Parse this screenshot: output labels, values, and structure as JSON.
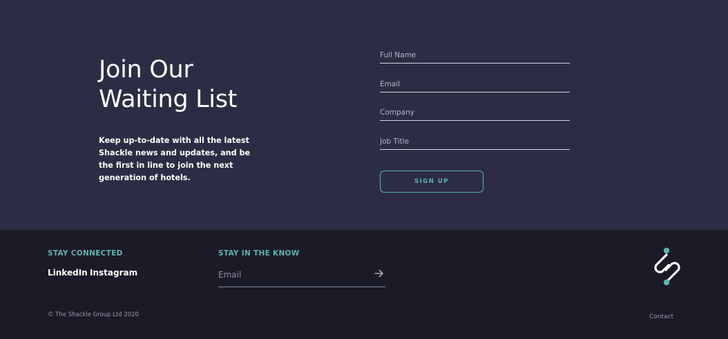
{
  "signup": {
    "heading_line1": "Join Our",
    "heading_line2": "Waiting List",
    "blurb": "Keep up-to-date with all the latest Shackle news and updates, and be the first in line to join the next generation of hotels.",
    "fields": {
      "full_name": {
        "placeholder": "Full Name",
        "value": ""
      },
      "email": {
        "placeholder": "Email",
        "value": ""
      },
      "company": {
        "placeholder": "Company",
        "value": ""
      },
      "job_title": {
        "placeholder": "Job Title",
        "value": ""
      }
    },
    "button_label": "SIGN UP"
  },
  "footer": {
    "stay_connected_label": "STAY CONNECTED",
    "social_links": [
      "LinkedIn",
      "Instagram"
    ],
    "stay_in_know_label": "STAY IN THE KNOW",
    "newsletter_placeholder": "Email",
    "newsletter_value": "",
    "submit_icon": "arrow-right-icon",
    "logo_icon": "shackle-logo-icon",
    "copyright": "© The Shackle Group Ltd 2020",
    "contact_link": "Contact"
  },
  "colors": {
    "signup_bg": "#2c2d44",
    "footer_bg": "#1b1b27",
    "accent": "#5fb3ad",
    "text": "#ffffff",
    "muted": "#9a9bab"
  }
}
